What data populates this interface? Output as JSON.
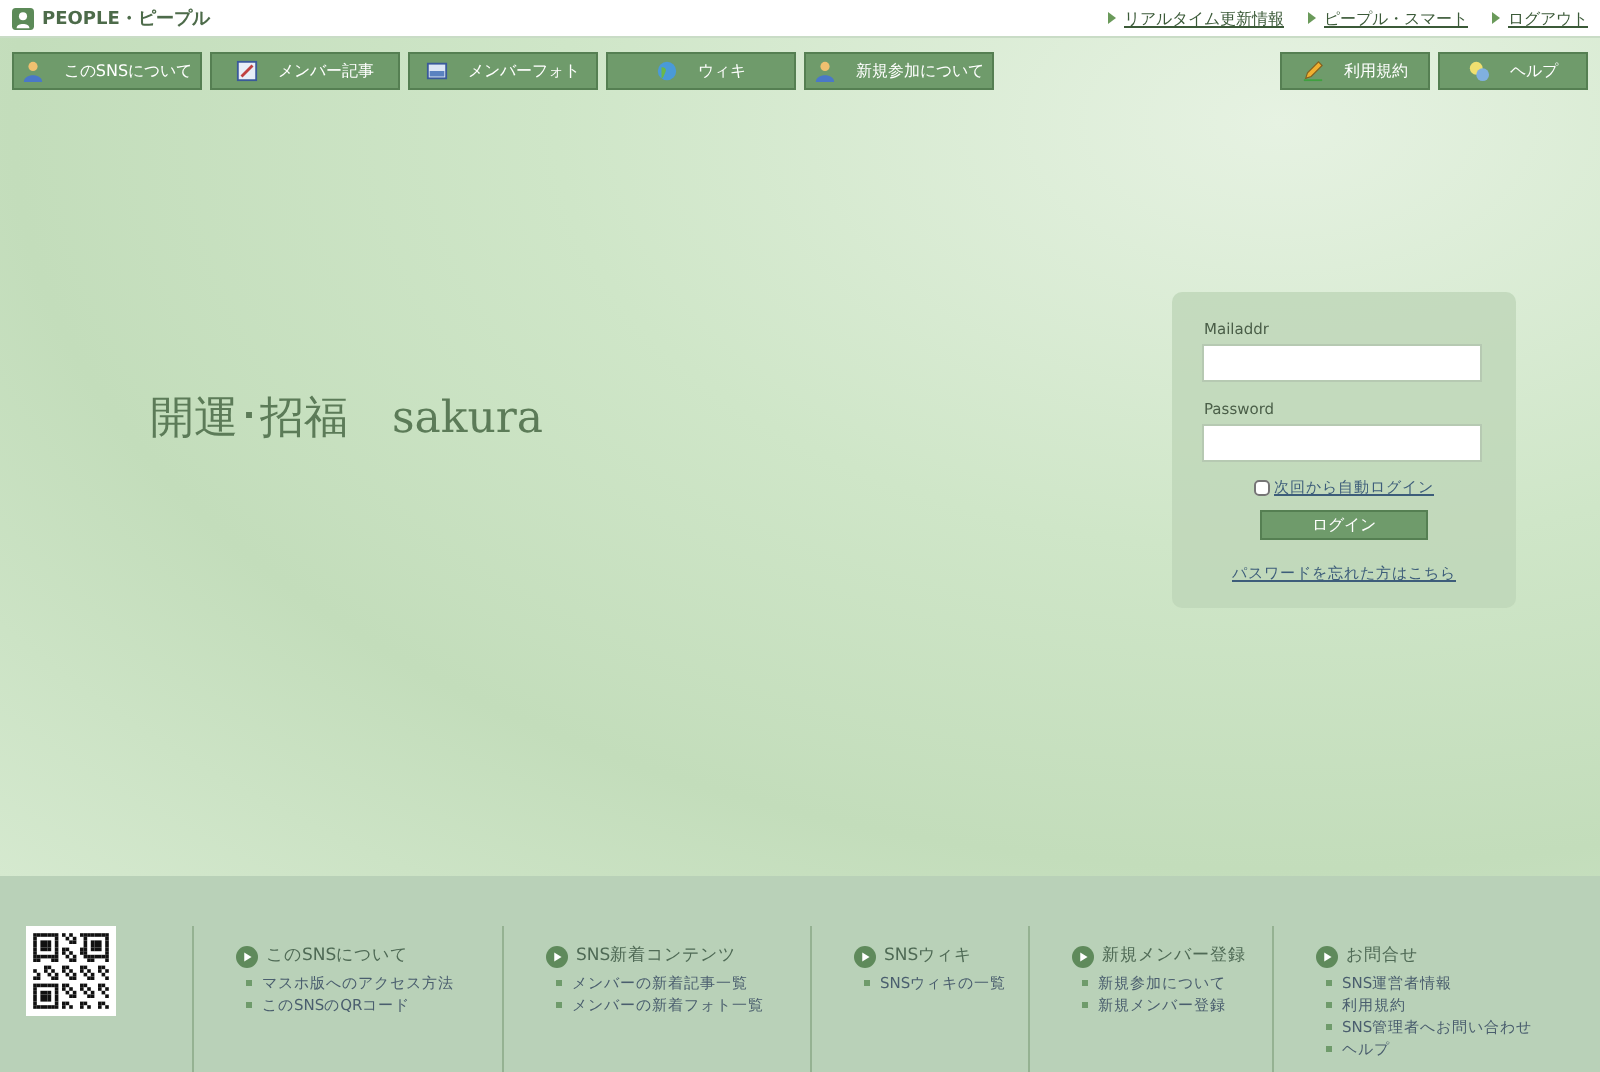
{
  "header": {
    "logo": "PEOPLE・ピープル",
    "links": [
      "リアルタイム更新情報",
      "ピープル・スマート",
      "ログアウト"
    ]
  },
  "nav": {
    "left": [
      "このSNSについて",
      "メンバー記事",
      "メンバーフォト",
      "ウィキ",
      "新規参加について"
    ],
    "right": [
      "利用規約",
      "ヘルプ"
    ]
  },
  "hero": {
    "title": "開運･招福　sakura"
  },
  "login": {
    "email_label": "Mailaddr",
    "password_label": "Password",
    "auto_login": {
      "label": "次回から自動ログイン",
      "checked": false
    },
    "button": "ログイン",
    "forgot_link": "パスワードを忘れた方はこちら"
  },
  "footer": {
    "columns": [
      {
        "heading": "このSNSについて",
        "links": [
          "マスホ版へのアクセス方法",
          "このSNSのQRコード"
        ]
      },
      {
        "heading": "SNS新着コンテンツ",
        "links": [
          "メンバーの新着記事一覧",
          "メンバーの新着フォト一覧"
        ]
      },
      {
        "heading": "SNSウィキ",
        "links": [
          "SNSウィキの一覧"
        ]
      },
      {
        "heading": "新規メンバー登録",
        "links": [
          "新規参加について",
          "新規メンバー登録"
        ]
      },
      {
        "heading": "お問合せ",
        "links": [
          "SNS運営者情報",
          "利用規約",
          "SNS管理者へお問い合わせ",
          "ヘルプ"
        ]
      }
    ]
  }
}
